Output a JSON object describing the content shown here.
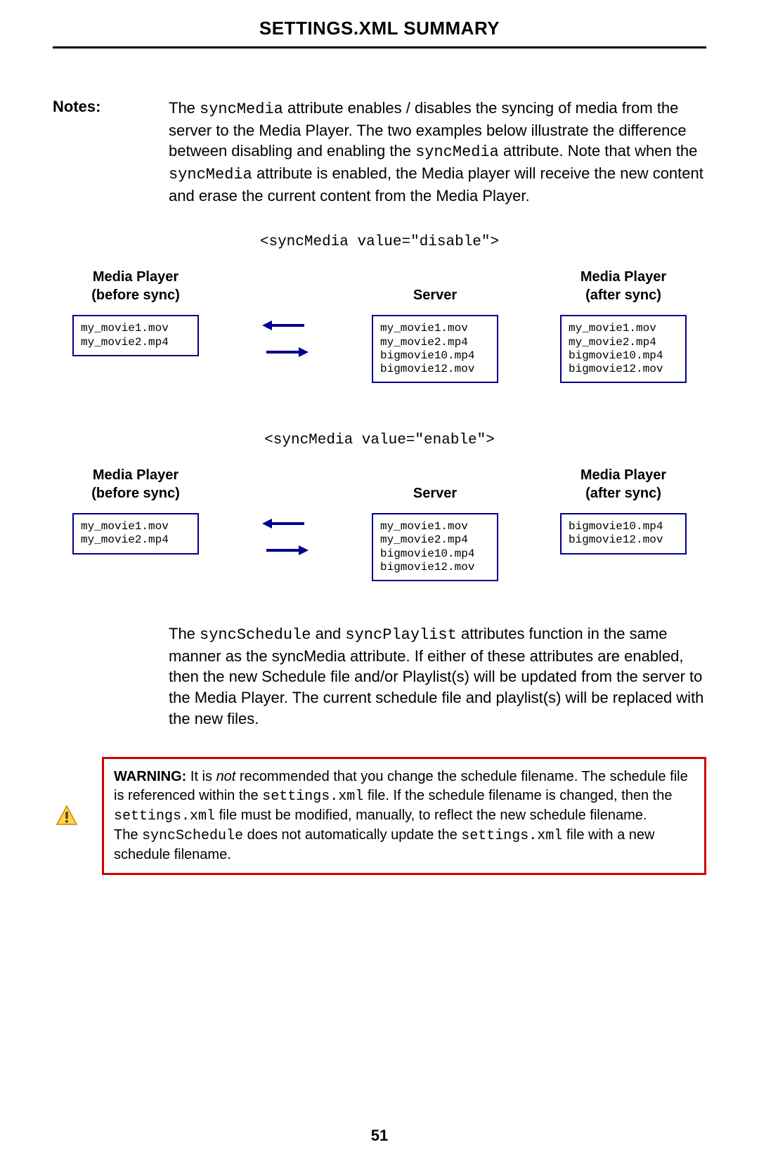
{
  "title": "SETTINGS.XML SUMMARY",
  "notesLabel": "Notes",
  "notesText": {
    "p1a": "The ",
    "p1b": "syncMedia",
    "p1c": " attribute enables / disables the syncing of media from the server to the Media Player.  The two examples below illustrate the difference between disabling and enabling the ",
    "p1d": "syncMedia",
    "p1e": " attribute.  Note that when the ",
    "p1f": "syncMedia",
    "p1g": " attribute is enabled, the Media player will receive the new content and erase the current content from the Media Player."
  },
  "diag1": {
    "code": "<syncMedia value=\"disable\">",
    "h1a": "Media Player",
    "h1b": "(before sync)",
    "h2": "Server",
    "h3a": "Media Player",
    "h3b": "(after sync)",
    "box1": "my_movie1.mov\nmy_movie2.mp4",
    "box2": "my_movie1.mov\nmy_movie2.mp4\nbigmovie10.mp4\nbigmovie12.mov",
    "box3": "my_movie1.mov\nmy_movie2.mp4\nbigmovie10.mp4\nbigmovie12.mov"
  },
  "diag2": {
    "code": "<syncMedia value=\"enable\">",
    "h1a": "Media Player",
    "h1b": "(before sync)",
    "h2": "Server",
    "h3a": "Media Player",
    "h3b": "(after sync)",
    "box1": "my_movie1.mov\nmy_movie2.mp4",
    "box2": "my_movie1.mov\nmy_movie2.mp4\nbigmovie10.mp4\nbigmovie12.mov",
    "box3": "bigmovie10.mp4\nbigmovie12.mov"
  },
  "para2": {
    "a": "The ",
    "b": "syncSchedule",
    "c": " and ",
    "d": "syncPlaylist",
    "e": " attributes function in the same manner as the syncMedia attribute.  If either of these attributes are enabled, then the new Schedule file and/or Playlist(s) will be updated from the server to the Media Player.  The current schedule file and playlist(s) will be replaced with the new files."
  },
  "warn": {
    "label": "WARNING:",
    "a": " It is ",
    "not": "not",
    "b": " recommended that you change the schedule filename.  The schedule file is referenced within the ",
    "c": "settings.xml",
    "d": " file.  If the schedule filename is changed, then the ",
    "e": "settings.xml",
    "f": " file must be modified, manually, to reflect the new schedule filename.",
    "g": "The ",
    "h": "syncSchedule",
    "i": " does not automatically update the ",
    "j": "settings.xml",
    "k": " file with a new schedule filename."
  },
  "pageNumber": "51"
}
